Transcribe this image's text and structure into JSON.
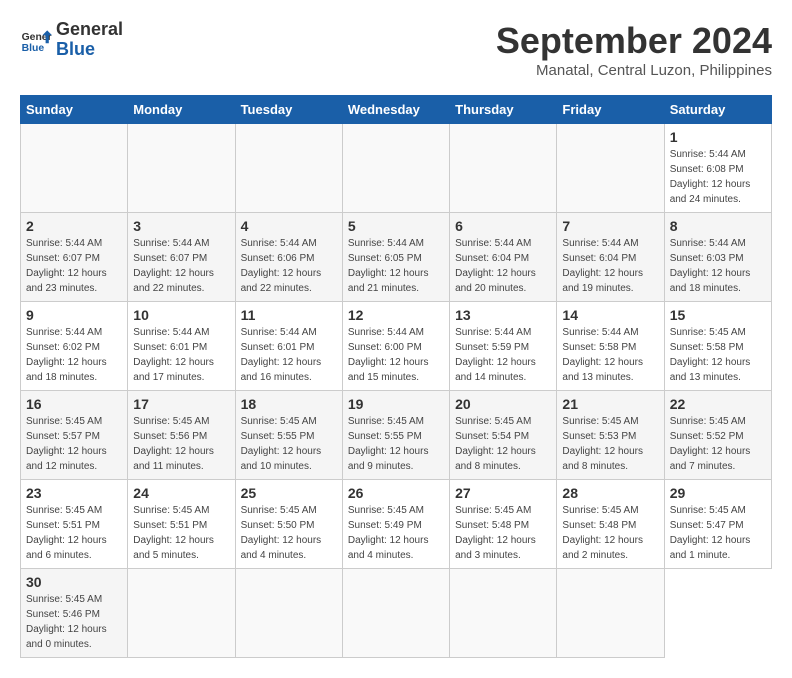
{
  "logo": {
    "line1": "General",
    "line2": "Blue"
  },
  "title": "September 2024",
  "location": "Manatal, Central Luzon, Philippines",
  "weekdays": [
    "Sunday",
    "Monday",
    "Tuesday",
    "Wednesday",
    "Thursday",
    "Friday",
    "Saturday"
  ],
  "days": [
    {
      "date": "",
      "detail": ""
    },
    {
      "date": "",
      "detail": ""
    },
    {
      "date": "",
      "detail": ""
    },
    {
      "date": "",
      "detail": ""
    },
    {
      "date": "",
      "detail": ""
    },
    {
      "date": "",
      "detail": ""
    },
    {
      "date": "1",
      "detail": "Sunrise: 5:44 AM\nSunset: 6:08 PM\nDaylight: 12 hours\nand 24 minutes."
    },
    {
      "date": "2",
      "detail": "Sunrise: 5:44 AM\nSunset: 6:07 PM\nDaylight: 12 hours\nand 23 minutes."
    },
    {
      "date": "3",
      "detail": "Sunrise: 5:44 AM\nSunset: 6:07 PM\nDaylight: 12 hours\nand 22 minutes."
    },
    {
      "date": "4",
      "detail": "Sunrise: 5:44 AM\nSunset: 6:06 PM\nDaylight: 12 hours\nand 22 minutes."
    },
    {
      "date": "5",
      "detail": "Sunrise: 5:44 AM\nSunset: 6:05 PM\nDaylight: 12 hours\nand 21 minutes."
    },
    {
      "date": "6",
      "detail": "Sunrise: 5:44 AM\nSunset: 6:04 PM\nDaylight: 12 hours\nand 20 minutes."
    },
    {
      "date": "7",
      "detail": "Sunrise: 5:44 AM\nSunset: 6:04 PM\nDaylight: 12 hours\nand 19 minutes."
    },
    {
      "date": "8",
      "detail": "Sunrise: 5:44 AM\nSunset: 6:03 PM\nDaylight: 12 hours\nand 18 minutes."
    },
    {
      "date": "9",
      "detail": "Sunrise: 5:44 AM\nSunset: 6:02 PM\nDaylight: 12 hours\nand 18 minutes."
    },
    {
      "date": "10",
      "detail": "Sunrise: 5:44 AM\nSunset: 6:01 PM\nDaylight: 12 hours\nand 17 minutes."
    },
    {
      "date": "11",
      "detail": "Sunrise: 5:44 AM\nSunset: 6:01 PM\nDaylight: 12 hours\nand 16 minutes."
    },
    {
      "date": "12",
      "detail": "Sunrise: 5:44 AM\nSunset: 6:00 PM\nDaylight: 12 hours\nand 15 minutes."
    },
    {
      "date": "13",
      "detail": "Sunrise: 5:44 AM\nSunset: 5:59 PM\nDaylight: 12 hours\nand 14 minutes."
    },
    {
      "date": "14",
      "detail": "Sunrise: 5:44 AM\nSunset: 5:58 PM\nDaylight: 12 hours\nand 13 minutes."
    },
    {
      "date": "15",
      "detail": "Sunrise: 5:45 AM\nSunset: 5:58 PM\nDaylight: 12 hours\nand 13 minutes."
    },
    {
      "date": "16",
      "detail": "Sunrise: 5:45 AM\nSunset: 5:57 PM\nDaylight: 12 hours\nand 12 minutes."
    },
    {
      "date": "17",
      "detail": "Sunrise: 5:45 AM\nSunset: 5:56 PM\nDaylight: 12 hours\nand 11 minutes."
    },
    {
      "date": "18",
      "detail": "Sunrise: 5:45 AM\nSunset: 5:55 PM\nDaylight: 12 hours\nand 10 minutes."
    },
    {
      "date": "19",
      "detail": "Sunrise: 5:45 AM\nSunset: 5:55 PM\nDaylight: 12 hours\nand 9 minutes."
    },
    {
      "date": "20",
      "detail": "Sunrise: 5:45 AM\nSunset: 5:54 PM\nDaylight: 12 hours\nand 8 minutes."
    },
    {
      "date": "21",
      "detail": "Sunrise: 5:45 AM\nSunset: 5:53 PM\nDaylight: 12 hours\nand 8 minutes."
    },
    {
      "date": "22",
      "detail": "Sunrise: 5:45 AM\nSunset: 5:52 PM\nDaylight: 12 hours\nand 7 minutes."
    },
    {
      "date": "23",
      "detail": "Sunrise: 5:45 AM\nSunset: 5:51 PM\nDaylight: 12 hours\nand 6 minutes."
    },
    {
      "date": "24",
      "detail": "Sunrise: 5:45 AM\nSunset: 5:51 PM\nDaylight: 12 hours\nand 5 minutes."
    },
    {
      "date": "25",
      "detail": "Sunrise: 5:45 AM\nSunset: 5:50 PM\nDaylight: 12 hours\nand 4 minutes."
    },
    {
      "date": "26",
      "detail": "Sunrise: 5:45 AM\nSunset: 5:49 PM\nDaylight: 12 hours\nand 4 minutes."
    },
    {
      "date": "27",
      "detail": "Sunrise: 5:45 AM\nSunset: 5:48 PM\nDaylight: 12 hours\nand 3 minutes."
    },
    {
      "date": "28",
      "detail": "Sunrise: 5:45 AM\nSunset: 5:48 PM\nDaylight: 12 hours\nand 2 minutes."
    },
    {
      "date": "29",
      "detail": "Sunrise: 5:45 AM\nSunset: 5:47 PM\nDaylight: 12 hours\nand 1 minute."
    },
    {
      "date": "30",
      "detail": "Sunrise: 5:45 AM\nSunset: 5:46 PM\nDaylight: 12 hours\nand 0 minutes."
    },
    {
      "date": "",
      "detail": ""
    },
    {
      "date": "",
      "detail": ""
    },
    {
      "date": "",
      "detail": ""
    },
    {
      "date": "",
      "detail": ""
    },
    {
      "date": "",
      "detail": ""
    }
  ]
}
